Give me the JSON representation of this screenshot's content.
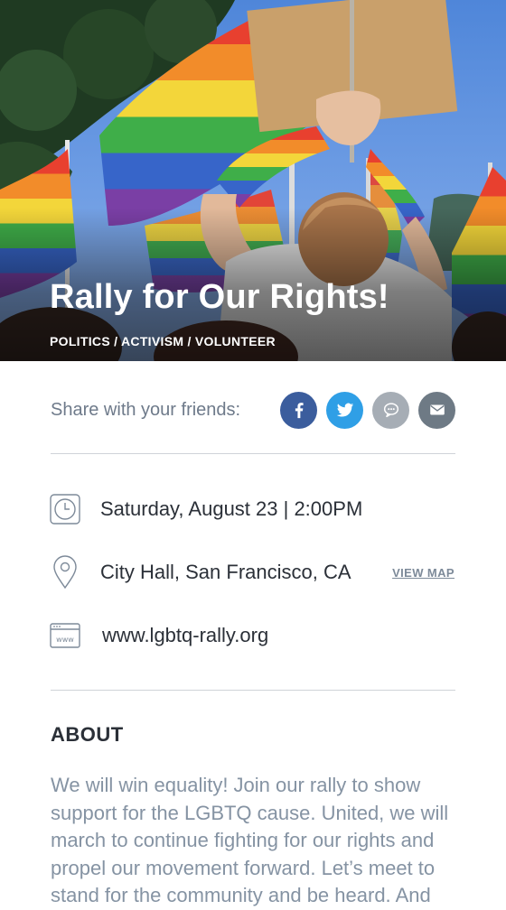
{
  "event": {
    "title": "Rally for Our Rights!",
    "categories": "POLITICS / ACTIVISM / VOLUNTEER"
  },
  "share": {
    "label": "Share with your friends:",
    "buttons": [
      {
        "icon": "facebook-icon",
        "color": "#3b5d9d"
      },
      {
        "icon": "twitter-icon",
        "color": "#2f9fe6"
      },
      {
        "icon": "message-icon",
        "color": "#a6adb5"
      },
      {
        "icon": "email-icon",
        "color": "#6e7a85"
      }
    ]
  },
  "details": {
    "datetime": "Saturday, August 23 | 2:00PM",
    "location": "City Hall, San Francisco, CA",
    "view_map": "VIEW MAP",
    "website": "www.lgbtq-rally.org",
    "web_icon_text": "www"
  },
  "about": {
    "heading": "ABOUT",
    "body": "We will win equality! Join our rally to show support for the LGBTQ cause. United, we will march to continue fighting for our rights and propel our movement forward. Let’s meet to stand for the community and be heard. And"
  },
  "colors": {
    "accent_text": "#8593a3",
    "divider": "#cfd3d8"
  }
}
